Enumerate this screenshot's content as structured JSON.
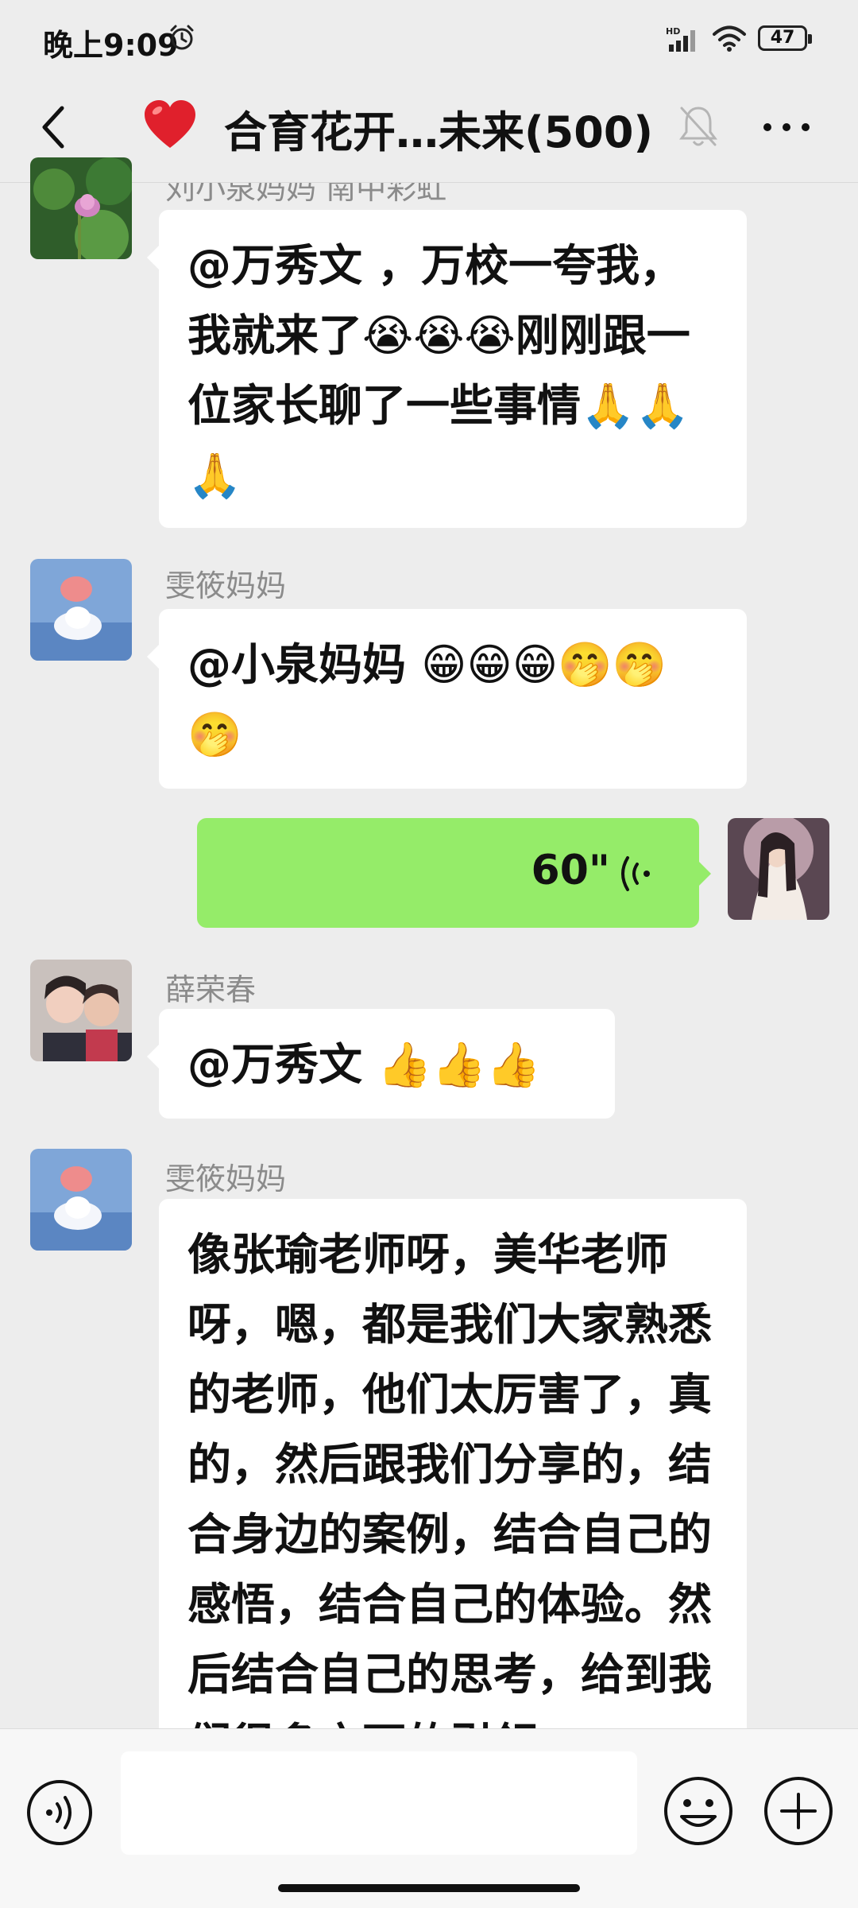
{
  "status_bar": {
    "time": "晚上9:09",
    "battery": "47",
    "network_label": "HD"
  },
  "header": {
    "title": "合育花开…未来(500)"
  },
  "messages": [
    {
      "sender": "刘小泉妈妈 南中彩虹",
      "text": "@万秀文 ，万校一夸我，我就来了😭😭😭刚刚跟一位家长聊了一些事情🙏🙏🙏"
    },
    {
      "sender": "雯筱妈妈",
      "text": "@小泉妈妈  😁😁😁🤭🤭🤭"
    },
    {
      "type": "voice",
      "sender": "self",
      "duration": "60\""
    },
    {
      "sender": "薛荣春",
      "text": "@万秀文 👍👍👍"
    },
    {
      "sender": "雯筱妈妈",
      "text": "像张瑜老师呀，美华老师呀，嗯，都是我们大家熟悉的老师，他们太厉害了，真的，然后跟我们分享的，结合身边的案例，结合自己的感悟，结合自己的体验。然后结合自己的思考，给到我们很多方面的引领"
    }
  ],
  "input_bar": {
    "placeholder": ""
  },
  "colors": {
    "background": "#ededed",
    "self_bubble": "#95ec69",
    "other_bubble": "#ffffff",
    "sender_name": "#8b8b8b"
  },
  "icons": [
    "alarm-icon",
    "signal-icon",
    "wifi-icon",
    "back-icon",
    "heart-icon",
    "mute-icon",
    "more-icon",
    "voice-wave-icon",
    "voice-toggle-icon",
    "emoji-button-icon",
    "plus-button-icon"
  ]
}
